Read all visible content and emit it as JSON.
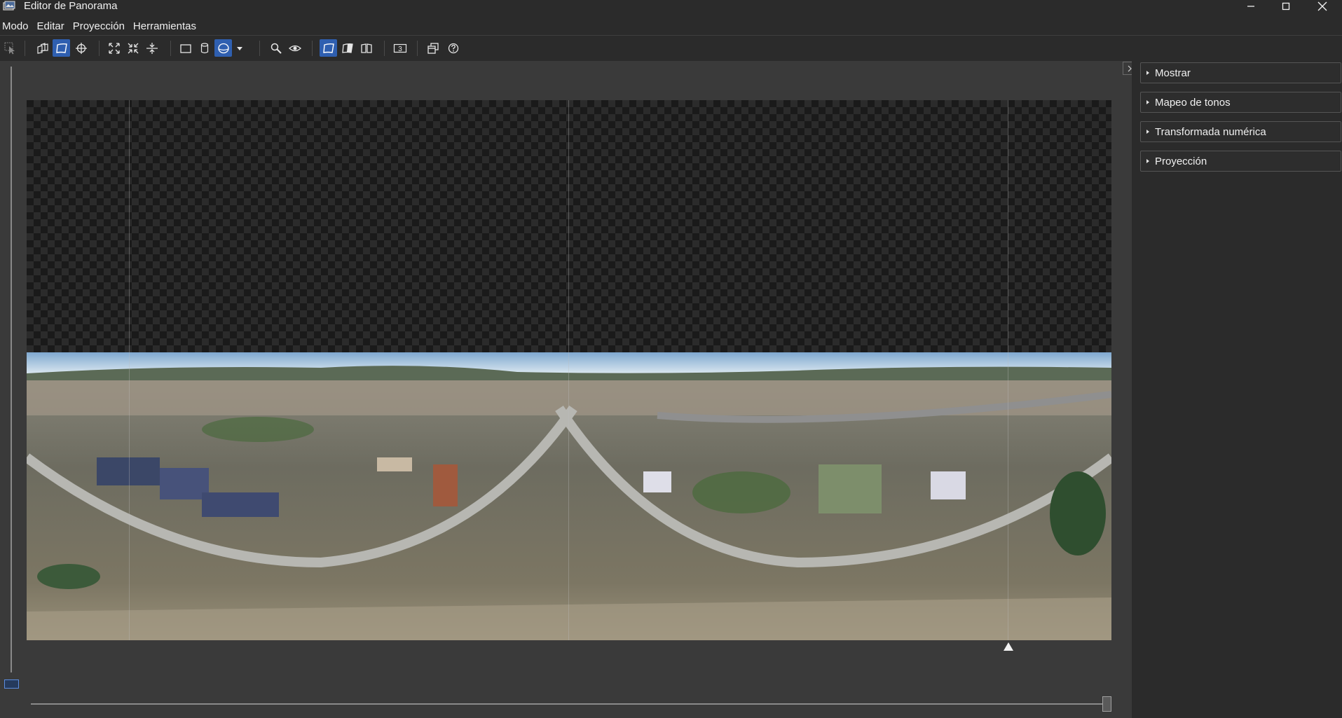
{
  "window": {
    "title": "Editor de Panorama",
    "icon": "panorama-app-icon"
  },
  "menu": {
    "items": [
      {
        "label": "Modo"
      },
      {
        "label": "Editar"
      },
      {
        "label": "Proyección"
      },
      {
        "label": "Herramientas"
      }
    ]
  },
  "toolbar": {
    "buttons": [
      {
        "icon": "select-pointer-icon",
        "active": false,
        "enabled": false
      },
      {
        "icon": "preview-images-icon",
        "active": false
      },
      {
        "icon": "drag-panorama-icon",
        "active": true
      },
      {
        "icon": "identify-crosshair-icon",
        "active": false
      },
      {
        "icon": "fit-expand-icon",
        "active": false
      },
      {
        "icon": "fit-contract-icon",
        "active": false
      },
      {
        "icon": "center-horizon-icon",
        "active": false
      },
      {
        "icon": "rectilinear-projection-icon",
        "active": false
      },
      {
        "icon": "cylindrical-projection-icon",
        "active": false
      },
      {
        "icon": "equirectangular-projection-icon",
        "active": true
      },
      {
        "icon": "projection-dropdown-icon",
        "active": false
      },
      {
        "icon": "zoom-icon",
        "active": false
      },
      {
        "icon": "preview-eye-icon",
        "active": false
      },
      {
        "icon": "display-mode-normal-icon",
        "active": true
      },
      {
        "icon": "display-mode-blend-icon",
        "active": false
      },
      {
        "icon": "display-mode-difference-icon",
        "active": false
      },
      {
        "icon": "stack-number-icon",
        "active": false,
        "label": "3"
      },
      {
        "icon": "overlay-windows-icon",
        "active": false
      },
      {
        "icon": "help-icon",
        "active": false
      }
    ]
  },
  "side_panel": {
    "sections": [
      {
        "label": "Mostrar",
        "expanded": false
      },
      {
        "label": "Mapeo de tonos",
        "expanded": false
      },
      {
        "label": "Transformada numérica",
        "expanded": false
      },
      {
        "label": "Proyección",
        "expanded": false
      }
    ]
  },
  "colors": {
    "accent": "#2f5fb0",
    "background": "#2b2b2b",
    "canvas_area": "#3a3a3a"
  }
}
